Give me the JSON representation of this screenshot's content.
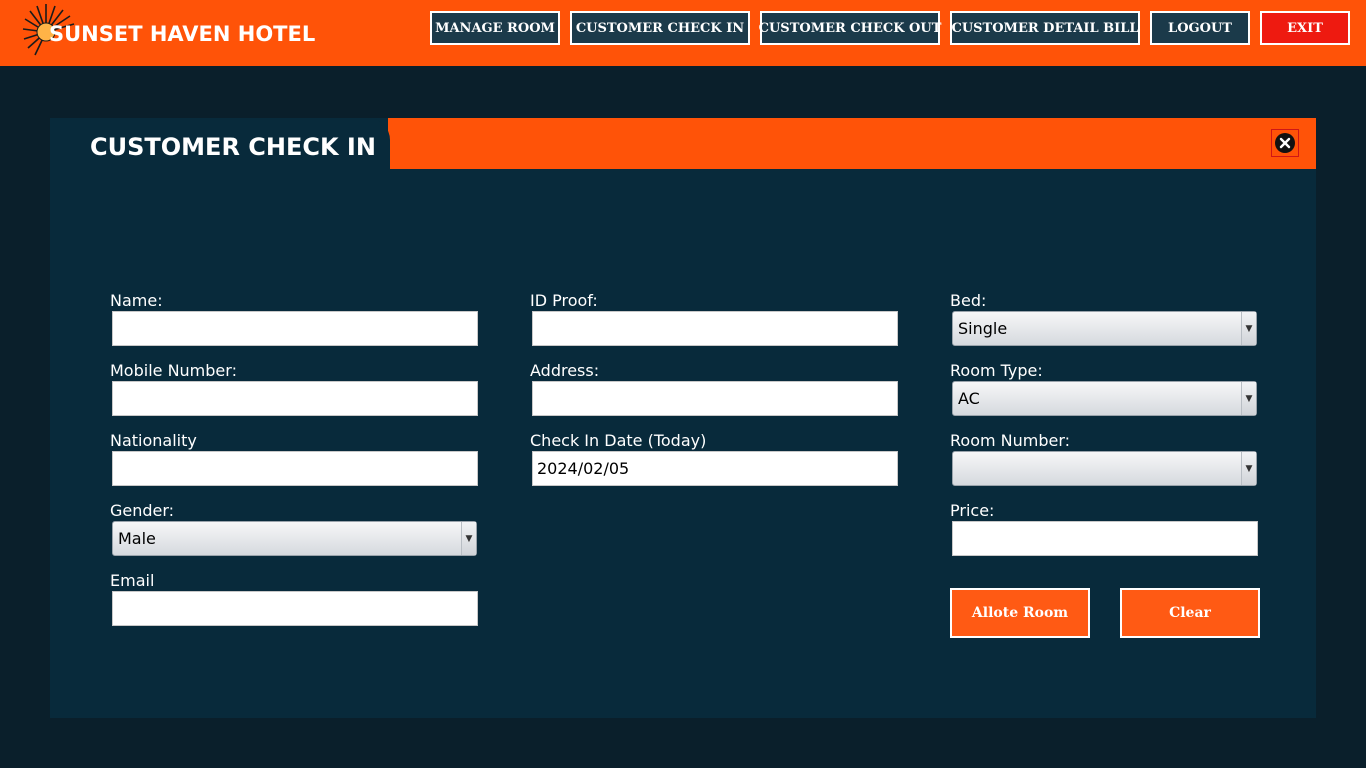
{
  "app": {
    "title": "SUNSET HAVEN HOTEL",
    "brand_color": "#ff5308",
    "background_color": "#0a1f2b"
  },
  "nav": {
    "manage_room": "MANAGE ROOM",
    "check_in": "CUSTOMER CHECK IN",
    "check_out": "CUSTOMER CHECK OUT",
    "detail_bill": "CUSTOMER DETAIL BILL",
    "logout": "LOGOUT",
    "exit": "EXIT",
    "exit_color": "#ee1a10"
  },
  "panel": {
    "title": "CUSTOMER CHECK IN",
    "close_icon": "close-circle-icon"
  },
  "form": {
    "name": {
      "label": "Name:",
      "value": ""
    },
    "mobile": {
      "label": "Mobile Number:",
      "value": ""
    },
    "nationality": {
      "label": "Nationality",
      "value": ""
    },
    "gender": {
      "label": "Gender:",
      "selected": "Male"
    },
    "email": {
      "label": "Email",
      "value": ""
    },
    "id_proof": {
      "label": "ID Proof:",
      "value": ""
    },
    "address": {
      "label": "Address:",
      "value": ""
    },
    "check_in_date": {
      "label": "Check In Date (Today)",
      "value": "2024/02/05"
    },
    "bed": {
      "label": "Bed:",
      "selected": "Single"
    },
    "room_type": {
      "label": "Room Type:",
      "selected": "AC"
    },
    "room_number": {
      "label": "Room Number:",
      "selected": ""
    },
    "price": {
      "label": "Price:",
      "value": ""
    }
  },
  "actions": {
    "allot": "Allote Room",
    "clear": "Clear"
  }
}
